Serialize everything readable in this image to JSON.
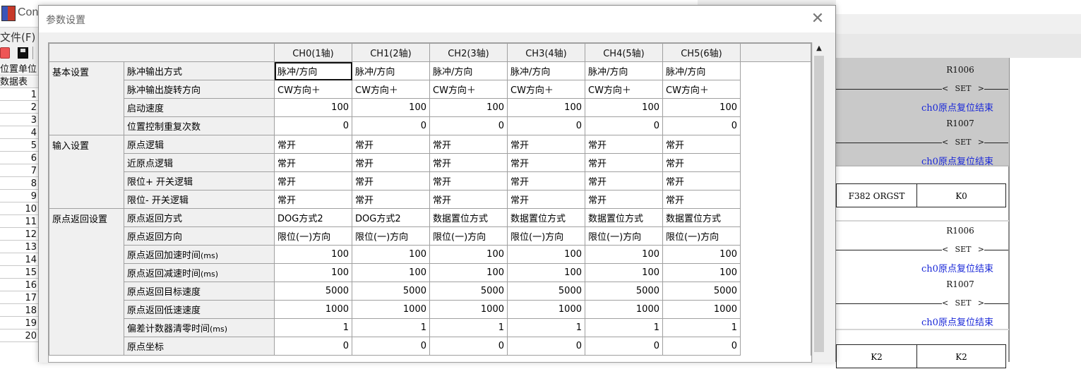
{
  "app": {
    "title": "Con",
    "menu_file": "文件(F)"
  },
  "left_list": {
    "header1": "位置单位",
    "header2": "数据表",
    "rows": [
      "1",
      "2",
      "3",
      "4",
      "5",
      "6",
      "7",
      "8",
      "9",
      "10",
      "11",
      "12",
      "13",
      "14",
      "15",
      "16",
      "17",
      "18",
      "19",
      "20"
    ]
  },
  "dialog": {
    "title": "参数设置",
    "close_icon": "close-icon",
    "columns": [
      "CH0(1轴)",
      "CH1(2轴)",
      "CH2(3轴)",
      "CH3(4轴)",
      "CH4(5轴)",
      "CH5(6轴)"
    ],
    "groups": [
      {
        "name": "基本设置",
        "params": [
          {
            "label": "脉冲输出方式",
            "unit": "",
            "values": [
              "脉冲/方向",
              "脉冲/方向",
              "脉冲/方向",
              "脉冲/方向",
              "脉冲/方向",
              "脉冲/方向"
            ],
            "align": "txt"
          },
          {
            "label": "脉冲输出旋转方向",
            "unit": "",
            "values": [
              "CW方向＋",
              "CW方向＋",
              "CW方向＋",
              "CW方向＋",
              "CW方向＋",
              "CW方向＋"
            ],
            "align": "txt"
          },
          {
            "label": "启动速度",
            "unit": "",
            "values": [
              "100",
              "100",
              "100",
              "100",
              "100",
              "100"
            ],
            "align": "num"
          },
          {
            "label": "位置控制重复次数",
            "unit": "",
            "values": [
              "0",
              "0",
              "0",
              "0",
              "0",
              "0"
            ],
            "align": "num"
          }
        ]
      },
      {
        "name": "输入设置",
        "params": [
          {
            "label": "原点逻辑",
            "unit": "",
            "values": [
              "常开",
              "常开",
              "常开",
              "常开",
              "常开",
              "常开"
            ],
            "align": "txt"
          },
          {
            "label": "近原点逻辑",
            "unit": "",
            "values": [
              "常开",
              "常开",
              "常开",
              "常开",
              "常开",
              "常开"
            ],
            "align": "txt"
          },
          {
            "label": "限位+ 开关逻辑",
            "unit": "",
            "values": [
              "常开",
              "常开",
              "常开",
              "常开",
              "常开",
              "常开"
            ],
            "align": "txt"
          },
          {
            "label": "限位- 开关逻辑",
            "unit": "",
            "values": [
              "常开",
              "常开",
              "常开",
              "常开",
              "常开",
              "常开"
            ],
            "align": "txt"
          }
        ]
      },
      {
        "name": "原点返回设置",
        "params": [
          {
            "label": "原点返回方式",
            "unit": "",
            "values": [
              "DOG方式2",
              "DOG方式2",
              "数据置位方式",
              "数据置位方式",
              "数据置位方式",
              "数据置位方式"
            ],
            "align": "txt"
          },
          {
            "label": "原点返回方向",
            "unit": "",
            "values": [
              "限位(一)方向",
              "限位(一)方向",
              "限位(一)方向",
              "限位(一)方向",
              "限位(一)方向",
              "限位(一)方向"
            ],
            "align": "txt"
          },
          {
            "label": "原点返回加速时间",
            "unit": "(ms)",
            "values": [
              "100",
              "100",
              "100",
              "100",
              "100",
              "100"
            ],
            "align": "num"
          },
          {
            "label": "原点返回减速时间",
            "unit": "(ms)",
            "values": [
              "100",
              "100",
              "100",
              "100",
              "100",
              "100"
            ],
            "align": "num"
          },
          {
            "label": "原点返回目标速度",
            "unit": "",
            "values": [
              "5000",
              "5000",
              "5000",
              "5000",
              "5000",
              "5000"
            ],
            "align": "num"
          },
          {
            "label": "原点返回低速速度",
            "unit": "",
            "values": [
              "1000",
              "1000",
              "1000",
              "1000",
              "1000",
              "1000"
            ],
            "align": "num"
          },
          {
            "label": "偏差计数器清零时间",
            "unit": "(ms)",
            "values": [
              "1",
              "1",
              "1",
              "1",
              "1",
              "1"
            ],
            "align": "num"
          },
          {
            "label": "原点坐标",
            "unit": "",
            "values": [
              "0",
              "0",
              "0",
              "0",
              "0",
              "0"
            ],
            "align": "num"
          }
        ]
      }
    ]
  },
  "ladder": {
    "relays": [
      "R1006",
      "R1007",
      "R1006",
      "R1007"
    ],
    "coil_label": "SET",
    "comment": "ch0原点复位结束",
    "instruction_1": "F382 ORGST",
    "operand_1": "K0",
    "operand_2a": "K2",
    "operand_2b": "K2"
  }
}
